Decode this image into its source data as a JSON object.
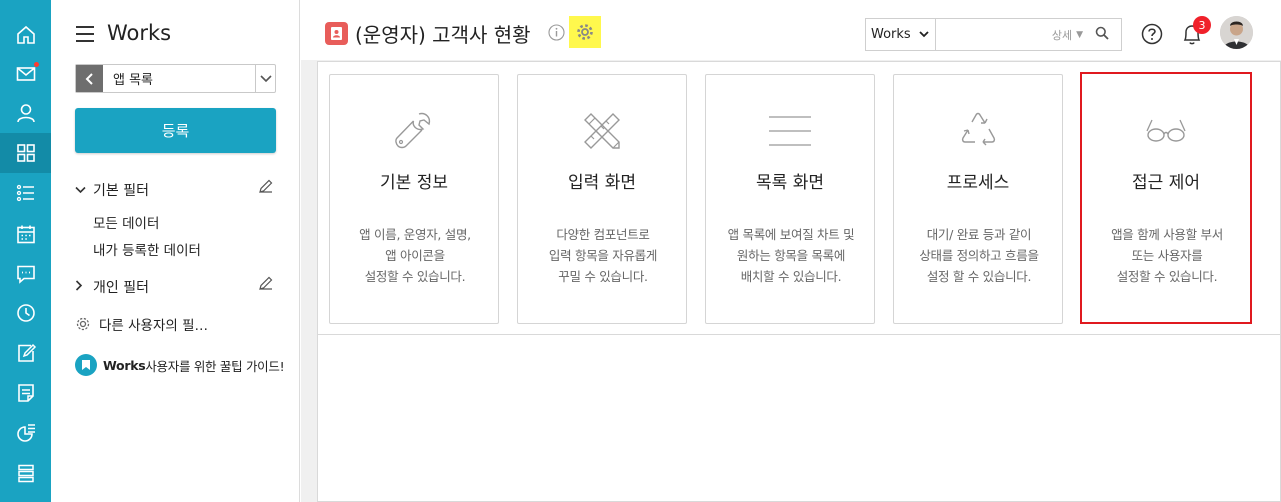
{
  "rail": {
    "items": [
      {
        "icon": "home-icon"
      },
      {
        "icon": "mail-icon",
        "badge_dot": true
      },
      {
        "icon": "person-icon"
      },
      {
        "icon": "apps-grid-icon",
        "active": true
      },
      {
        "icon": "list-icon"
      },
      {
        "icon": "calendar-icon"
      },
      {
        "icon": "chat-icon"
      },
      {
        "icon": "clock-icon"
      },
      {
        "icon": "edit-icon"
      },
      {
        "icon": "note-icon"
      },
      {
        "icon": "pie-chart-icon"
      },
      {
        "icon": "stack-icon"
      }
    ],
    "color": "#1aa3c2"
  },
  "sidebar": {
    "title": "Works",
    "app_select": "앱 목록",
    "register_label": "등록",
    "basic_filter": {
      "label": "기본 필터",
      "items": [
        "모든 데이터",
        "내가 등록한 데이터"
      ]
    },
    "personal_filter": {
      "label": "개인 필터"
    },
    "other_users": "다른 사용자의 필…",
    "guide": {
      "brand": "Works",
      "text": " 사용자를 위한 꿀팁 가이드!"
    }
  },
  "header": {
    "title": "(운영자) 고객사 현황",
    "search": {
      "scope": "Works",
      "value": "",
      "detail_label": "상세"
    },
    "notification_count": "3"
  },
  "cards": [
    {
      "title": "기본 정보",
      "desc": "앱 이름, 운영자, 설명,\n앱 아이콘을\n설정할 수 있습니다.",
      "icon": "wrench-icon"
    },
    {
      "title": "입력 화면",
      "desc": "다양한 컴포넌트로\n입력 항목을 자유롭게\n꾸밀 수 있습니다.",
      "icon": "ruler-pencil-icon"
    },
    {
      "title": "목록 화면",
      "desc": "앱 목록에 보여질 차트 및\n원하는 항목을 목록에\n배치할 수 있습니다.",
      "icon": "lines-icon"
    },
    {
      "title": "프로세스",
      "desc": "대기/ 완료 등과 같이\n상태를 정의하고 흐름을\n설정 할 수 있습니다.",
      "icon": "recycle-icon"
    },
    {
      "title": "접근 제어",
      "desc": "앱을 함께 사용할 부서\n또는 사용자를\n설정할 수 있습니다.",
      "icon": "glasses-icon",
      "selected": true
    }
  ],
  "colors": {
    "accent": "#1aa3c2",
    "highlight": "#fff84d",
    "selection": "#e0191f",
    "badge": "#f0212b",
    "page_icon": "#e85d5a"
  }
}
